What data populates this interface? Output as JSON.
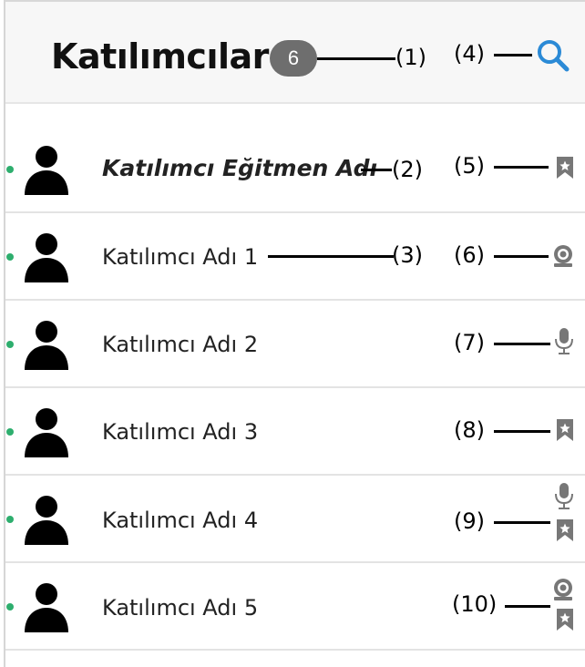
{
  "header": {
    "title": "Katılımcılar",
    "count": "6"
  },
  "annotations": [
    "(1)",
    "(2)",
    "(3)",
    "(4)",
    "(5)",
    "(6)",
    "(7)",
    "(8)",
    "(9)",
    "(10)"
  ],
  "participants": [
    {
      "name": "Katılımcı Eğitmen Adı",
      "role": "instructor",
      "online": true,
      "icons": [
        "bookmark-star-icon"
      ]
    },
    {
      "name": "Katılımcı Adı 1",
      "online": true,
      "icons": [
        "webcam-icon"
      ]
    },
    {
      "name": "Katılımcı Adı 2",
      "online": true,
      "icons": [
        "microphone-icon"
      ]
    },
    {
      "name": "Katılımcı Adı 3",
      "online": true,
      "icons": [
        "bookmark-star-icon"
      ]
    },
    {
      "name": "Katılımcı Adı 4",
      "online": true,
      "icons": [
        "microphone-icon",
        "bookmark-star-icon"
      ]
    },
    {
      "name": "Katılımcı Adı 5",
      "online": true,
      "icons": [
        "webcam-icon",
        "bookmark-star-icon"
      ]
    }
  ],
  "colors": {
    "accent": "#2b8ad6",
    "online": "#2eae6e",
    "badge": "#6e6e6e",
    "icon_gray": "#777777"
  }
}
